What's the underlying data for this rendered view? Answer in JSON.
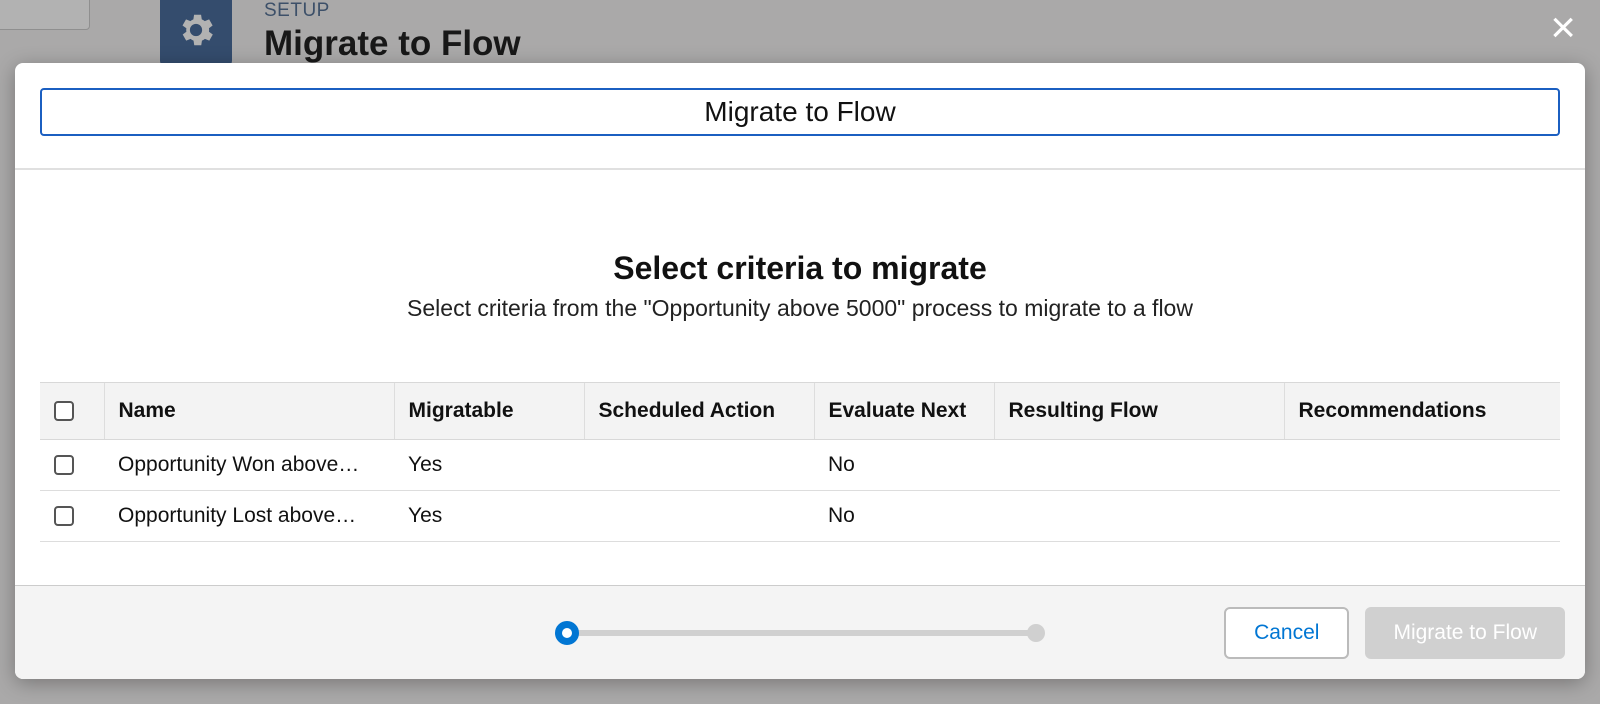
{
  "background": {
    "setup_label": "SETUP",
    "page_title": "Migrate to Flow"
  },
  "modal": {
    "title": "Migrate to Flow",
    "heading": "Select criteria to migrate",
    "subheading": "Select criteria from the \"Opportunity above 5000\" process to migrate to a flow",
    "columns": {
      "name": "Name",
      "migratable": "Migratable",
      "scheduled": "Scheduled Action",
      "evaluate": "Evaluate Next",
      "resulting": "Resulting Flow",
      "recs": "Recommendations"
    },
    "rows": [
      {
        "name": "Opportunity Won above…",
        "migratable": "Yes",
        "scheduled": "",
        "evaluate": "No",
        "resulting": "",
        "recs": ""
      },
      {
        "name": "Opportunity Lost above…",
        "migratable": "Yes",
        "scheduled": "",
        "evaluate": "No",
        "resulting": "",
        "recs": ""
      }
    ],
    "footer": {
      "cancel": "Cancel",
      "migrate": "Migrate to Flow"
    }
  }
}
